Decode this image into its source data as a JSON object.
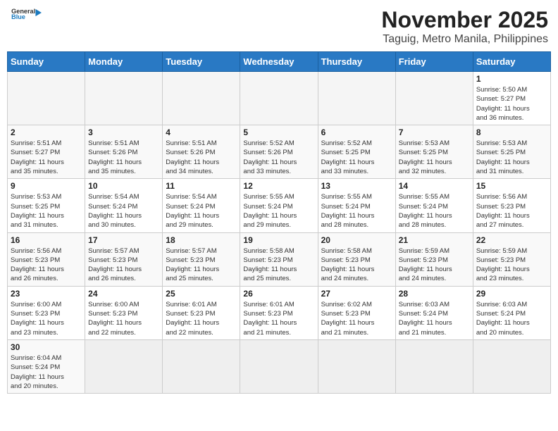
{
  "header": {
    "logo_line1": "General",
    "logo_line2": "Blue",
    "month": "November 2025",
    "location": "Taguig, Metro Manila, Philippines"
  },
  "weekdays": [
    "Sunday",
    "Monday",
    "Tuesday",
    "Wednesday",
    "Thursday",
    "Friday",
    "Saturday"
  ],
  "weeks": [
    [
      {
        "day": "",
        "info": ""
      },
      {
        "day": "",
        "info": ""
      },
      {
        "day": "",
        "info": ""
      },
      {
        "day": "",
        "info": ""
      },
      {
        "day": "",
        "info": ""
      },
      {
        "day": "",
        "info": ""
      },
      {
        "day": "1",
        "info": "Sunrise: 5:50 AM\nSunset: 5:27 PM\nDaylight: 11 hours\nand 36 minutes."
      }
    ],
    [
      {
        "day": "2",
        "info": "Sunrise: 5:51 AM\nSunset: 5:27 PM\nDaylight: 11 hours\nand 35 minutes."
      },
      {
        "day": "3",
        "info": "Sunrise: 5:51 AM\nSunset: 5:26 PM\nDaylight: 11 hours\nand 35 minutes."
      },
      {
        "day": "4",
        "info": "Sunrise: 5:51 AM\nSunset: 5:26 PM\nDaylight: 11 hours\nand 34 minutes."
      },
      {
        "day": "5",
        "info": "Sunrise: 5:52 AM\nSunset: 5:26 PM\nDaylight: 11 hours\nand 33 minutes."
      },
      {
        "day": "6",
        "info": "Sunrise: 5:52 AM\nSunset: 5:25 PM\nDaylight: 11 hours\nand 33 minutes."
      },
      {
        "day": "7",
        "info": "Sunrise: 5:53 AM\nSunset: 5:25 PM\nDaylight: 11 hours\nand 32 minutes."
      },
      {
        "day": "8",
        "info": "Sunrise: 5:53 AM\nSunset: 5:25 PM\nDaylight: 11 hours\nand 31 minutes."
      }
    ],
    [
      {
        "day": "9",
        "info": "Sunrise: 5:53 AM\nSunset: 5:25 PM\nDaylight: 11 hours\nand 31 minutes."
      },
      {
        "day": "10",
        "info": "Sunrise: 5:54 AM\nSunset: 5:24 PM\nDaylight: 11 hours\nand 30 minutes."
      },
      {
        "day": "11",
        "info": "Sunrise: 5:54 AM\nSunset: 5:24 PM\nDaylight: 11 hours\nand 29 minutes."
      },
      {
        "day": "12",
        "info": "Sunrise: 5:55 AM\nSunset: 5:24 PM\nDaylight: 11 hours\nand 29 minutes."
      },
      {
        "day": "13",
        "info": "Sunrise: 5:55 AM\nSunset: 5:24 PM\nDaylight: 11 hours\nand 28 minutes."
      },
      {
        "day": "14",
        "info": "Sunrise: 5:55 AM\nSunset: 5:24 PM\nDaylight: 11 hours\nand 28 minutes."
      },
      {
        "day": "15",
        "info": "Sunrise: 5:56 AM\nSunset: 5:23 PM\nDaylight: 11 hours\nand 27 minutes."
      }
    ],
    [
      {
        "day": "16",
        "info": "Sunrise: 5:56 AM\nSunset: 5:23 PM\nDaylight: 11 hours\nand 26 minutes."
      },
      {
        "day": "17",
        "info": "Sunrise: 5:57 AM\nSunset: 5:23 PM\nDaylight: 11 hours\nand 26 minutes."
      },
      {
        "day": "18",
        "info": "Sunrise: 5:57 AM\nSunset: 5:23 PM\nDaylight: 11 hours\nand 25 minutes."
      },
      {
        "day": "19",
        "info": "Sunrise: 5:58 AM\nSunset: 5:23 PM\nDaylight: 11 hours\nand 25 minutes."
      },
      {
        "day": "20",
        "info": "Sunrise: 5:58 AM\nSunset: 5:23 PM\nDaylight: 11 hours\nand 24 minutes."
      },
      {
        "day": "21",
        "info": "Sunrise: 5:59 AM\nSunset: 5:23 PM\nDaylight: 11 hours\nand 24 minutes."
      },
      {
        "day": "22",
        "info": "Sunrise: 5:59 AM\nSunset: 5:23 PM\nDaylight: 11 hours\nand 23 minutes."
      }
    ],
    [
      {
        "day": "23",
        "info": "Sunrise: 6:00 AM\nSunset: 5:23 PM\nDaylight: 11 hours\nand 23 minutes."
      },
      {
        "day": "24",
        "info": "Sunrise: 6:00 AM\nSunset: 5:23 PM\nDaylight: 11 hours\nand 22 minutes."
      },
      {
        "day": "25",
        "info": "Sunrise: 6:01 AM\nSunset: 5:23 PM\nDaylight: 11 hours\nand 22 minutes."
      },
      {
        "day": "26",
        "info": "Sunrise: 6:01 AM\nSunset: 5:23 PM\nDaylight: 11 hours\nand 21 minutes."
      },
      {
        "day": "27",
        "info": "Sunrise: 6:02 AM\nSunset: 5:23 PM\nDaylight: 11 hours\nand 21 minutes."
      },
      {
        "day": "28",
        "info": "Sunrise: 6:03 AM\nSunset: 5:24 PM\nDaylight: 11 hours\nand 21 minutes."
      },
      {
        "day": "29",
        "info": "Sunrise: 6:03 AM\nSunset: 5:24 PM\nDaylight: 11 hours\nand 20 minutes."
      }
    ],
    [
      {
        "day": "30",
        "info": "Sunrise: 6:04 AM\nSunset: 5:24 PM\nDaylight: 11 hours\nand 20 minutes."
      },
      {
        "day": "",
        "info": ""
      },
      {
        "day": "",
        "info": ""
      },
      {
        "day": "",
        "info": ""
      },
      {
        "day": "",
        "info": ""
      },
      {
        "day": "",
        "info": ""
      },
      {
        "day": "",
        "info": ""
      }
    ]
  ]
}
